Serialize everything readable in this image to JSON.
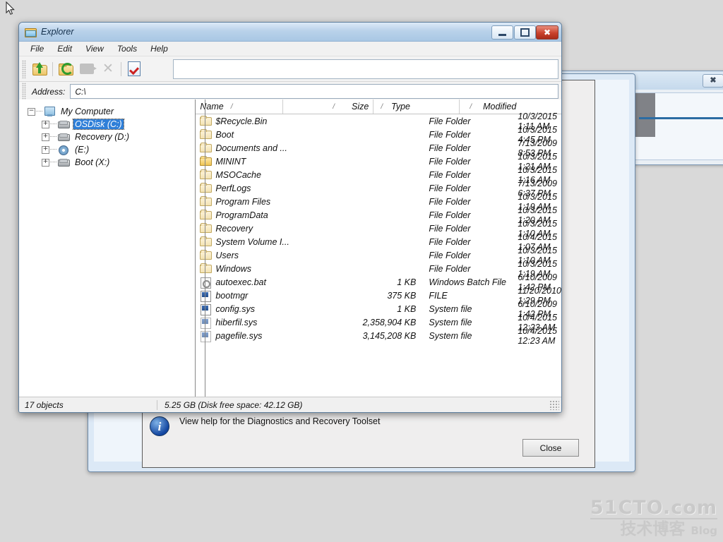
{
  "explorer": {
    "title": "Explorer",
    "title_icon": "folder-icon",
    "window_buttons": {
      "minimize": "minimize-icon",
      "maximize": "maximize-icon",
      "close": "close-icon"
    },
    "menu": [
      "File",
      "Edit",
      "View",
      "Tools",
      "Help"
    ],
    "toolbar": [
      {
        "name": "up-one-level-icon",
        "enabled": true
      },
      {
        "name": "refresh-folder-icon",
        "enabled": true
      },
      {
        "name": "paste-icon",
        "enabled": false
      },
      {
        "name": "delete-icon",
        "enabled": false
      },
      {
        "name": "properties-icon",
        "enabled": true
      }
    ],
    "address": {
      "label": "Address:",
      "value": "C:\\",
      "placeholder": "C:\\"
    },
    "tree": [
      {
        "label": "My Computer",
        "icon": "computer-icon",
        "expander": "minus",
        "indent": 0,
        "selected": false
      },
      {
        "label": "OSDisk (C:)",
        "icon": "harddisk-icon",
        "expander": "plus",
        "indent": 1,
        "selected": true
      },
      {
        "label": "Recovery (D:)",
        "icon": "harddisk-icon",
        "expander": "plus",
        "indent": 1,
        "selected": false
      },
      {
        "label": "(E:)",
        "icon": "cd-drive-icon",
        "expander": "plus",
        "indent": 1,
        "selected": false
      },
      {
        "label": "Boot (X:)",
        "icon": "harddisk-icon",
        "expander": "plus",
        "indent": 1,
        "selected": false
      }
    ],
    "columns": [
      "Name",
      "Size",
      "Type",
      "Modified"
    ],
    "sort_mark": "/",
    "rows": [
      {
        "name": "$Recycle.Bin",
        "size": "",
        "type": "File Folder",
        "modified": "10/3/2015 1:11 AM",
        "icon": "folder-icon"
      },
      {
        "name": "Boot",
        "size": "",
        "type": "File Folder",
        "modified": "10/3/2015 4:45 PM",
        "icon": "folder-icon"
      },
      {
        "name": "Documents and ...",
        "size": "",
        "type": "File Folder",
        "modified": "7/13/2009 8:53 PM",
        "icon": "folder-icon"
      },
      {
        "name": "MININT",
        "size": "",
        "type": "File Folder",
        "modified": "10/3/2015 1:21 AM",
        "icon": "folder-highlight-icon"
      },
      {
        "name": "MSOCache",
        "size": "",
        "type": "File Folder",
        "modified": "10/3/2015 1:16 AM",
        "icon": "folder-icon"
      },
      {
        "name": "PerfLogs",
        "size": "",
        "type": "File Folder",
        "modified": "7/13/2009 6:37 PM",
        "icon": "folder-icon"
      },
      {
        "name": "Program Files",
        "size": "",
        "type": "File Folder",
        "modified": "10/3/2015 1:19 AM",
        "icon": "folder-icon"
      },
      {
        "name": "ProgramData",
        "size": "",
        "type": "File Folder",
        "modified": "10/3/2015 1:20 AM",
        "icon": "folder-icon"
      },
      {
        "name": "Recovery",
        "size": "",
        "type": "File Folder",
        "modified": "10/3/2015 1:10 AM",
        "icon": "folder-icon"
      },
      {
        "name": "System Volume I...",
        "size": "",
        "type": "File Folder",
        "modified": "10/4/2015 1:07 AM",
        "icon": "folder-icon"
      },
      {
        "name": "Users",
        "size": "",
        "type": "File Folder",
        "modified": "10/3/2015 1:10 AM",
        "icon": "folder-icon"
      },
      {
        "name": "Windows",
        "size": "",
        "type": "File Folder",
        "modified": "10/3/2015 1:19 AM",
        "icon": "folder-icon"
      },
      {
        "name": "autoexec.bat",
        "size": "1 KB",
        "type": "Windows Batch File",
        "modified": "6/10/2009 1:42 PM",
        "icon": "batch-file-icon"
      },
      {
        "name": "bootmgr",
        "size": "375 KB",
        "type": "FILE",
        "modified": "11/20/2010 1:29 PM",
        "icon": "system-file-icon"
      },
      {
        "name": "config.sys",
        "size": "1 KB",
        "type": "System file",
        "modified": "6/10/2009 1:42 PM",
        "icon": "system-file-icon"
      },
      {
        "name": "hiberfil.sys",
        "size": "2,358,904 KB",
        "type": "System file",
        "modified": "10/4/2015 12:23 AM",
        "icon": "system-file-dim-icon"
      },
      {
        "name": "pagefile.sys",
        "size": "3,145,208 KB",
        "type": "System file",
        "modified": "10/4/2015 12:23 AM",
        "icon": "system-file-dim-icon"
      }
    ],
    "status": {
      "objects": "17 objects",
      "size": "5.25 GB (Disk free space: 42.12 GB)"
    }
  },
  "dialog": {
    "help_text": "View help for the Diagnostics and Recovery Toolset",
    "close_label": "Close",
    "info_icon": "info-icon"
  },
  "background_windows": {
    "right_close": "close-icon",
    "mid_close": "close-icon"
  },
  "watermark": {
    "top": "51CTO.com",
    "chinese": "技术博客",
    "blog": "Blog"
  },
  "cursor": {
    "name": "mouse-pointer"
  }
}
